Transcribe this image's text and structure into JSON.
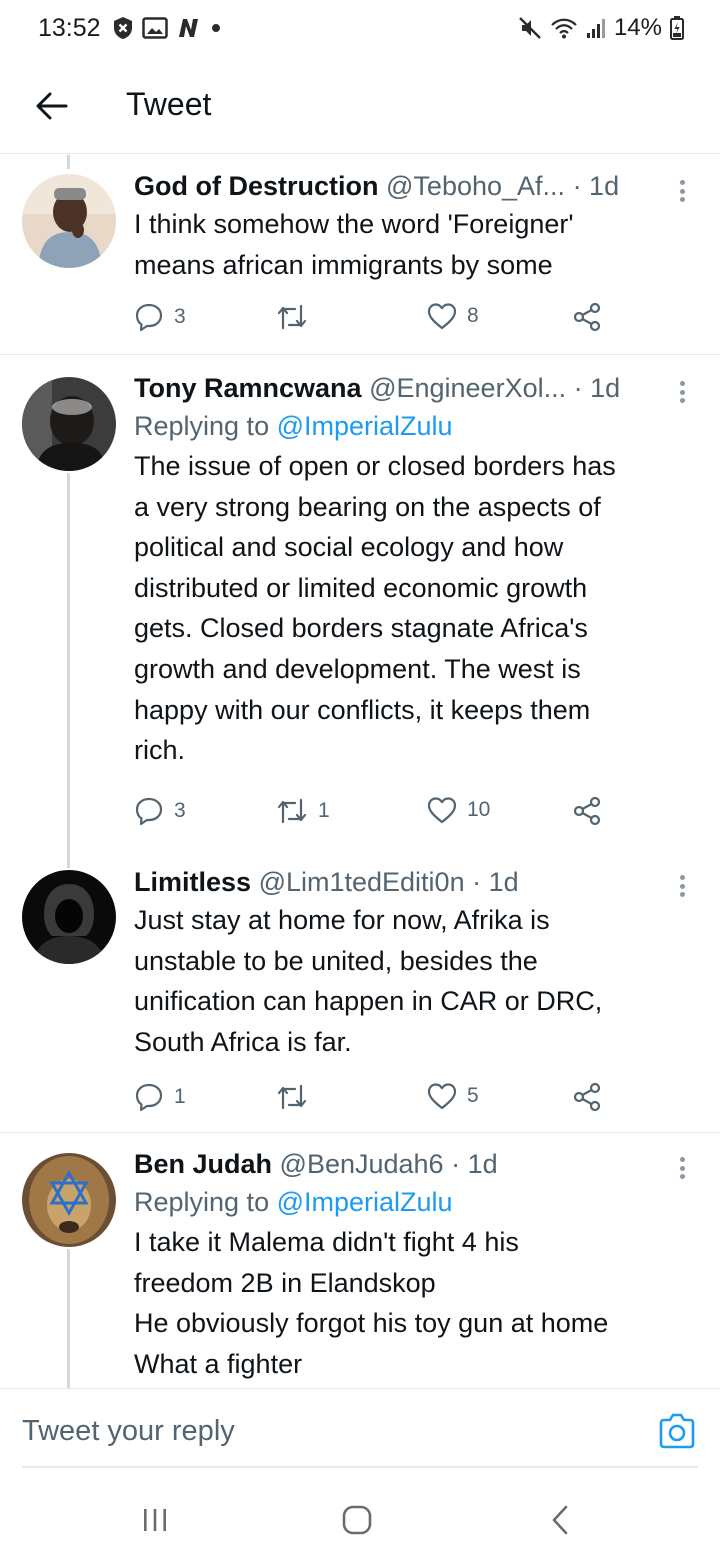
{
  "status_bar": {
    "time": "13:52",
    "battery": "14%"
  },
  "header": {
    "title": "Tweet"
  },
  "tweets": [
    {
      "name": "God of Destruction",
      "handle": "@Teboho_Af...",
      "time": "· 1d",
      "replying_prefix": "",
      "replying_handle": "",
      "lines": [
        "I think somehow the word 'Foreigner'",
        "means african immigrants by some"
      ],
      "replies": "3",
      "retweets": "",
      "likes": "8",
      "avatar_color": "#c99d8a"
    },
    {
      "name": "Tony Ramncwana",
      "handle": "@EngineerXol...",
      "time": "· 1d",
      "replying_prefix": "Replying to",
      "replying_handle": "@ImperialZulu",
      "lines": [
        "The issue of open or closed borders has",
        "a very strong bearing on the aspects of",
        "political and social ecology and how",
        "distributed or limited economic growth",
        "gets. Closed borders stagnate Africa's",
        "growth and development. The west is",
        "happy with our conflicts, it keeps them",
        "rich."
      ],
      "replies": "3",
      "retweets": "1",
      "likes": "10",
      "avatar_color": "#2b2b2b"
    },
    {
      "name": "Limitless",
      "handle": "@Lim1tedEditi0n",
      "time": "· 1d",
      "replying_prefix": "",
      "replying_handle": "",
      "lines": [
        "Just stay at home for now, Afrika is",
        "unstable to be united, besides the",
        "unification can happen in CAR or DRC,",
        "South Africa is far."
      ],
      "replies": "1",
      "retweets": "",
      "likes": "5",
      "avatar_color": "#111111"
    },
    {
      "name": "Ben Judah",
      "handle": "@BenJudah6",
      "time": "· 1d",
      "replying_prefix": "Replying to",
      "replying_handle": "@ImperialZulu",
      "lines": [
        "I take it Malema didn't fight 4 his",
        "freedom 2B in Elandskop",
        "He obviously forgot his toy gun at home",
        "What a fighter"
      ],
      "replies": "",
      "retweets": "",
      "likes": "",
      "avatar_color": "#8a6a45"
    }
  ],
  "reply_bar": {
    "placeholder": "Tweet your reply"
  },
  "colors": {
    "accent": "#1d9bf0",
    "text": "#0f1419",
    "secondary": "#536471",
    "divider": "#e7e9ea"
  },
  "icons": {
    "status_left": [
      "shield-x-icon",
      "image-icon",
      "n-app-icon",
      "dot-icon"
    ],
    "status_right": [
      "mute-icon",
      "wifi-icon",
      "signal-icon",
      "battery-icon"
    ],
    "actions": [
      "reply-icon",
      "retweet-icon",
      "like-icon",
      "share-icon"
    ],
    "nav": [
      "recents-icon",
      "home-icon",
      "back-icon"
    ]
  }
}
